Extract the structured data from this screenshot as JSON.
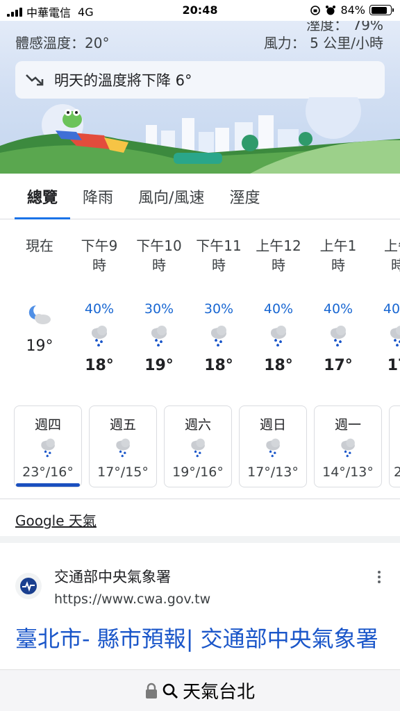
{
  "status_bar": {
    "carrier": "中華電信",
    "network": "4G",
    "time": "20:48",
    "battery": "84%",
    "battery_level": 0.84
  },
  "hero": {
    "humidity_cut": "溼度： 79%",
    "feels_like": "體感溫度：20°",
    "wind": "風力： 5 公里/小時",
    "forecast_message": "明天的溫度將下降 6°",
    "trend_icon": "trending-down-icon"
  },
  "tabs": [
    {
      "label": "總覽",
      "active": true
    },
    {
      "label": "降雨",
      "active": false
    },
    {
      "label": "風向/風速",
      "active": false
    },
    {
      "label": "溼度",
      "active": false
    }
  ],
  "hourly": [
    {
      "time_line1": "現在",
      "time_line2": "",
      "precip": "",
      "temp": "19°",
      "icon": "night-cloudy-icon"
    },
    {
      "time_line1": "下午9",
      "time_line2": "時",
      "precip": "40%",
      "temp": "18°",
      "icon": "rain-icon"
    },
    {
      "time_line1": "下午10",
      "time_line2": "時",
      "precip": "30%",
      "temp": "19°",
      "icon": "rain-icon"
    },
    {
      "time_line1": "下午11",
      "time_line2": "時",
      "precip": "30%",
      "temp": "18°",
      "icon": "rain-icon"
    },
    {
      "time_line1": "上午12",
      "time_line2": "時",
      "precip": "40%",
      "temp": "18°",
      "icon": "rain-icon"
    },
    {
      "time_line1": "上午1",
      "time_line2": "時",
      "precip": "40%",
      "temp": "17°",
      "icon": "rain-icon"
    },
    {
      "time_line1": "上午",
      "time_line2": "時",
      "precip": "40%",
      "temp": "17",
      "icon": "rain-icon"
    }
  ],
  "daily": [
    {
      "day": "週四",
      "temps": "23°/16°",
      "icon": "rain-icon",
      "active": true
    },
    {
      "day": "週五",
      "temps": "17°/15°",
      "icon": "rain-icon",
      "active": false
    },
    {
      "day": "週六",
      "temps": "19°/16°",
      "icon": "rain-icon",
      "active": false
    },
    {
      "day": "週日",
      "temps": "17°/13°",
      "icon": "rain-icon",
      "active": false
    },
    {
      "day": "週一",
      "temps": "14°/13°",
      "icon": "rain-icon",
      "active": false
    },
    {
      "day": "",
      "temps": "2",
      "icon": "",
      "active": false
    }
  ],
  "source_link": "Google 天氣",
  "result": {
    "site_name": "交通部中央氣象署",
    "url": "https://www.cwa.gov.tw",
    "title": "臺北市- 縣市預報| 交通部中央氣象署"
  },
  "address_bar": {
    "query": "天氣台北",
    "lock_icon": "lock-icon",
    "search_icon": "search-icon"
  },
  "colors": {
    "accent": "#1a73e8",
    "precip": "#1967d2",
    "link": "#1a56c9"
  }
}
